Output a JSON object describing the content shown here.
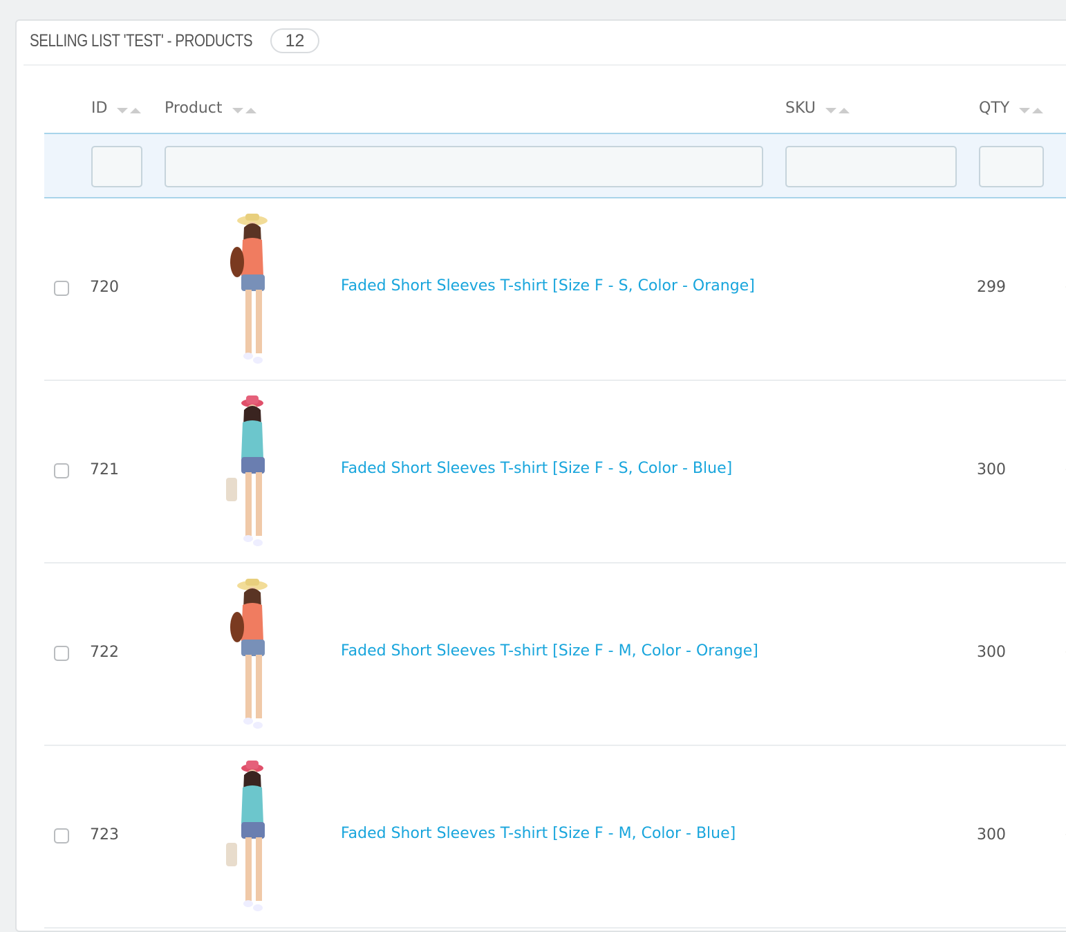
{
  "panel": {
    "title": "SELLING LIST 'TEST' - PRODUCTS",
    "count": "12"
  },
  "table": {
    "columns": [
      {
        "label": "ID",
        "sortable": true
      },
      {
        "label": "Product",
        "sortable": true
      },
      {
        "label": "SKU",
        "sortable": true
      },
      {
        "label": "QTY",
        "sortable": true
      }
    ],
    "filters": {
      "id": "",
      "product": "",
      "sku": "",
      "qty": ""
    },
    "rows": [
      {
        "id": "720",
        "image": "model-orange-shirt-straw-hat",
        "product": "Faded Short Sleeves T-shirt [Size F - S, Color - Orange]",
        "sku": "",
        "qty": "299",
        "checked": false
      },
      {
        "id": "721",
        "image": "model-blue-shirt-pink-hat",
        "product": "Faded Short Sleeves T-shirt [Size F - S, Color - Blue]",
        "sku": "",
        "qty": "300",
        "checked": false
      },
      {
        "id": "722",
        "image": "model-orange-shirt-straw-hat",
        "product": "Faded Short Sleeves T-shirt [Size F - M, Color - Orange]",
        "sku": "",
        "qty": "300",
        "checked": false
      },
      {
        "id": "723",
        "image": "model-blue-shirt-pink-hat",
        "product": "Faded Short Sleeves T-shirt [Size F - M, Color - Blue]",
        "sku": "",
        "qty": "300",
        "checked": false
      }
    ]
  },
  "colors": {
    "link": "#18a5dc",
    "filter_row_bg": "#eef5fc",
    "filter_row_border": "#a8d4ea",
    "page_bg": "#eff1f2"
  }
}
